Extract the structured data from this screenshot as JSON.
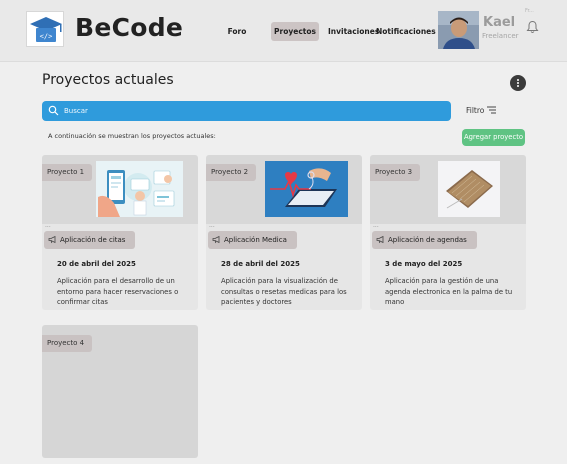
{
  "brand": {
    "name": "BeCode",
    "logo_icon": "graduation-cap-code-icon"
  },
  "nav": {
    "items": [
      {
        "label": "Foro",
        "active": false
      },
      {
        "label": "Proyectos",
        "active": true
      },
      {
        "label": "Invitaciones",
        "active": false
      },
      {
        "label": "Notificaciones",
        "active": false
      }
    ]
  },
  "user": {
    "name": "Kael",
    "role": "Freelancer",
    "extra": "Fr...",
    "notification_icon": "bell-icon"
  },
  "page": {
    "title": "Proyectos actuales",
    "more_icon": "more-vertical-icon"
  },
  "search": {
    "placeholder": "Buscar",
    "value": "",
    "icon": "search-icon"
  },
  "filter": {
    "label": "Filtro",
    "icon": "filter-lines-icon"
  },
  "intro_text": "A continuación se muestran los proyectos actuales:",
  "add_button": {
    "label": "Agregar proyecto"
  },
  "projects": [
    {
      "tag": "Proyecto 1",
      "dots": "...",
      "category": "Aplicación de citas",
      "date": "20 de abril del 2025",
      "description": "Aplicación para el desarrollo de un entorno para hacer reservaciones o confirmar citas"
    },
    {
      "tag": "Proyecto 2",
      "dots": "...",
      "category": "Aplicación Medica",
      "date": "28 de abril del 2025",
      "description": "Aplicación para la visualización de consultas o resetas medicas para los pacientes y doctores"
    },
    {
      "tag": "Proyecto 3",
      "dots": "...",
      "category": "Aplicación de agendas",
      "date": "3 de mayo del 2025",
      "description": "Aplicación para la gestión de una agenda electronica en la palma de tu mano"
    },
    {
      "tag": "Proyecto 4"
    }
  ],
  "colors": {
    "search_bar": "#2f9bdc",
    "add_button": "#5fc383",
    "tag_bg": "#c9c2c2",
    "nav_active": "#ccc4c4"
  }
}
